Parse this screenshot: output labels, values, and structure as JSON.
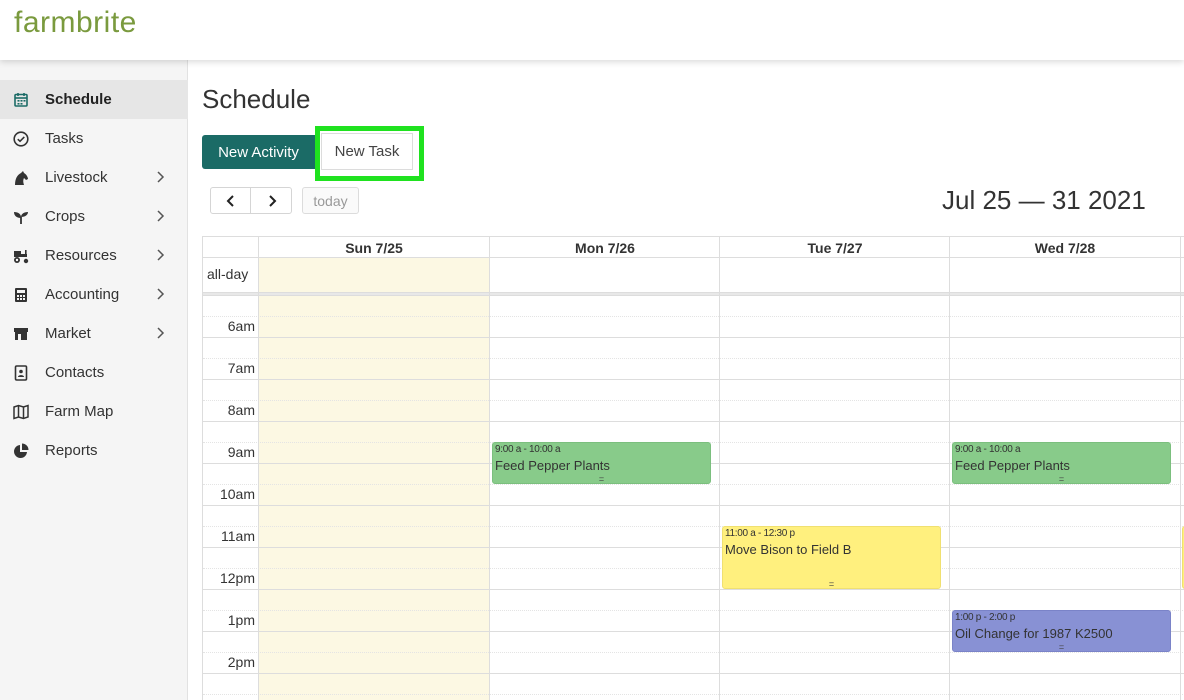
{
  "app": {
    "logo": "farmbrite"
  },
  "sidebar": {
    "items": [
      {
        "label": "Schedule",
        "icon": "calendar-icon",
        "active": true,
        "submenu": false
      },
      {
        "label": "Tasks",
        "icon": "check-circle-icon",
        "active": false,
        "submenu": false
      },
      {
        "label": "Livestock",
        "icon": "horse-icon",
        "active": false,
        "submenu": true
      },
      {
        "label": "Crops",
        "icon": "seedling-icon",
        "active": false,
        "submenu": true
      },
      {
        "label": "Resources",
        "icon": "tractor-icon",
        "active": false,
        "submenu": true
      },
      {
        "label": "Accounting",
        "icon": "calculator-icon",
        "active": false,
        "submenu": true
      },
      {
        "label": "Market",
        "icon": "store-icon",
        "active": false,
        "submenu": true
      },
      {
        "label": "Contacts",
        "icon": "address-book-icon",
        "active": false,
        "submenu": false
      },
      {
        "label": "Farm Map",
        "icon": "map-icon",
        "active": false,
        "submenu": false
      },
      {
        "label": "Reports",
        "icon": "pie-chart-icon",
        "active": false,
        "submenu": false
      }
    ]
  },
  "main": {
    "title": "Schedule",
    "new_activity_label": "New Activity",
    "new_task_label": "New Task",
    "today_label": "today",
    "range_title": "Jul 25 — 31 2021"
  },
  "calendar": {
    "days": [
      "Sun 7/25",
      "Mon 7/26",
      "Tue 7/27",
      "Wed 7/28"
    ],
    "allday_label": "all-day",
    "hours": [
      "6am",
      "7am",
      "8am",
      "9am",
      "10am",
      "11am",
      "12pm",
      "1pm",
      "2pm"
    ],
    "events": [
      {
        "day": "Mon 7/26",
        "time": "9:00 a - 10:00 a",
        "title": "Feed Pepper Plants",
        "color": "#88cb8a"
      },
      {
        "day": "Wed 7/28",
        "time": "9:00 a - 10:00 a",
        "title": "Feed Pepper Plants",
        "color": "#88cb8a"
      },
      {
        "day": "Tue 7/27",
        "time": "11:00 a - 12:30 p",
        "title": "Move Bison to Field B",
        "color": "#fff07e"
      },
      {
        "day": "Wed 7/28",
        "time": "1:00 p - 2:00 p",
        "title": "Oil Change for 1987 K2500",
        "color": "#8891d4"
      }
    ],
    "resize_handle": "="
  },
  "colors": {
    "brand": "#7a9a3e",
    "primary_button": "#1b6b66",
    "highlight": "#1fe21f",
    "today_bg": "#fcf8e3"
  }
}
